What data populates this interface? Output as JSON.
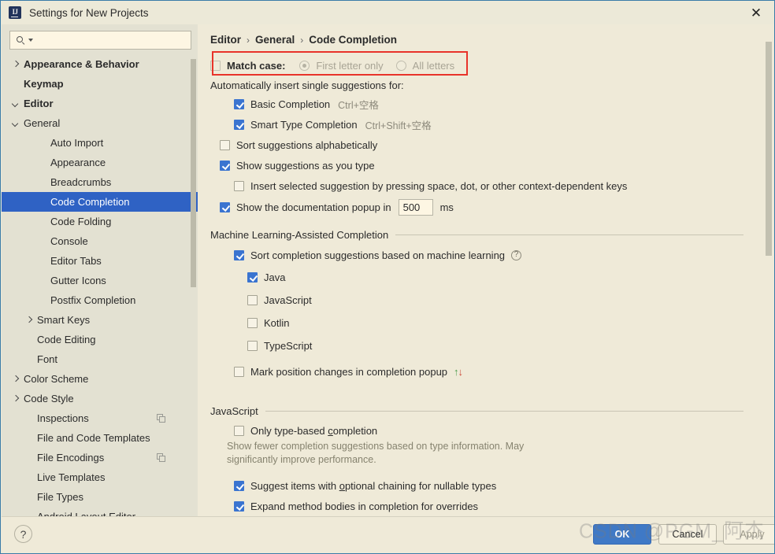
{
  "window": {
    "title": "Settings for New Projects",
    "logo_alt": "IJ",
    "close_label": "✕"
  },
  "sidebar": {
    "search": {
      "value": "",
      "placeholder": ""
    },
    "items": [
      {
        "label": "Appearance & Behavior",
        "indent": 0,
        "twisty": "right",
        "bold": true,
        "selected": false,
        "badge": false
      },
      {
        "label": "Keymap",
        "indent": 1,
        "twisty": "none",
        "bold": true,
        "selected": false,
        "badge": false
      },
      {
        "label": "Editor",
        "indent": 0,
        "twisty": "down",
        "bold": true,
        "selected": false,
        "badge": false
      },
      {
        "label": "General",
        "indent": 1,
        "twisty": "down",
        "bold": false,
        "selected": false,
        "badge": false
      },
      {
        "label": "Auto Import",
        "indent": 3,
        "twisty": "none",
        "bold": false,
        "selected": false,
        "badge": false
      },
      {
        "label": "Appearance",
        "indent": 3,
        "twisty": "none",
        "bold": false,
        "selected": false,
        "badge": false
      },
      {
        "label": "Breadcrumbs",
        "indent": 3,
        "twisty": "none",
        "bold": false,
        "selected": false,
        "badge": false
      },
      {
        "label": "Code Completion",
        "indent": 3,
        "twisty": "none",
        "bold": false,
        "selected": true,
        "badge": false
      },
      {
        "label": "Code Folding",
        "indent": 3,
        "twisty": "none",
        "bold": false,
        "selected": false,
        "badge": false
      },
      {
        "label": "Console",
        "indent": 3,
        "twisty": "none",
        "bold": false,
        "selected": false,
        "badge": false
      },
      {
        "label": "Editor Tabs",
        "indent": 3,
        "twisty": "none",
        "bold": false,
        "selected": false,
        "badge": false
      },
      {
        "label": "Gutter Icons",
        "indent": 3,
        "twisty": "none",
        "bold": false,
        "selected": false,
        "badge": false
      },
      {
        "label": "Postfix Completion",
        "indent": 3,
        "twisty": "none",
        "bold": false,
        "selected": false,
        "badge": false
      },
      {
        "label": "Smart Keys",
        "indent": 2,
        "twisty": "right",
        "bold": false,
        "selected": false,
        "badge": false
      },
      {
        "label": "Code Editing",
        "indent": 2,
        "twisty": "none",
        "bold": false,
        "selected": false,
        "badge": false
      },
      {
        "label": "Font",
        "indent": 2,
        "twisty": "none",
        "bold": false,
        "selected": false,
        "badge": false
      },
      {
        "label": "Color Scheme",
        "indent": 1,
        "twisty": "right",
        "bold": false,
        "selected": false,
        "badge": false
      },
      {
        "label": "Code Style",
        "indent": 1,
        "twisty": "right",
        "bold": false,
        "selected": false,
        "badge": false
      },
      {
        "label": "Inspections",
        "indent": 2,
        "twisty": "none",
        "bold": false,
        "selected": false,
        "badge": true
      },
      {
        "label": "File and Code Templates",
        "indent": 2,
        "twisty": "none",
        "bold": false,
        "selected": false,
        "badge": false
      },
      {
        "label": "File Encodings",
        "indent": 2,
        "twisty": "none",
        "bold": false,
        "selected": false,
        "badge": true
      },
      {
        "label": "Live Templates",
        "indent": 2,
        "twisty": "none",
        "bold": false,
        "selected": false,
        "badge": false
      },
      {
        "label": "File Types",
        "indent": 2,
        "twisty": "none",
        "bold": false,
        "selected": false,
        "badge": false
      },
      {
        "label": "Android Layout Editor",
        "indent": 2,
        "twisty": "none",
        "bold": false,
        "selected": false,
        "badge": false
      }
    ]
  },
  "breadcrumb": {
    "parts": [
      "Editor",
      "General",
      "Code Completion"
    ],
    "separator": "›"
  },
  "main": {
    "match_case": {
      "label": "Match case:",
      "checked": false,
      "options": [
        {
          "label": "First letter only",
          "selected": true
        },
        {
          "label": "All letters",
          "selected": false
        }
      ]
    },
    "auto_insert_heading": "Automatically insert single suggestions for:",
    "auto_insert_items": [
      {
        "label": "Basic Completion",
        "shortcut": "Ctrl+空格",
        "checked": true
      },
      {
        "label": "Smart Type Completion",
        "shortcut": "Ctrl+Shift+空格",
        "checked": true
      }
    ],
    "sort_alphabetically": {
      "label": "Sort suggestions alphabetically",
      "checked": false
    },
    "show_as_you_type": {
      "label": "Show suggestions as you type",
      "checked": true
    },
    "insert_selected": {
      "label": "Insert selected suggestion by pressing space, dot, or other context-dependent keys",
      "checked": false
    },
    "doc_popup": {
      "label": "Show the documentation popup in",
      "checked": true,
      "value": "500",
      "unit": "ms"
    },
    "ml_section": {
      "title": "Machine Learning-Assisted Completion",
      "sort_ml": {
        "label": "Sort completion suggestions based on machine learning",
        "checked": true,
        "help": "?"
      },
      "languages": [
        {
          "label": "Java",
          "checked": true
        },
        {
          "label": "JavaScript",
          "checked": false
        },
        {
          "label": "Kotlin",
          "checked": false
        },
        {
          "label": "TypeScript",
          "checked": false
        }
      ],
      "mark_position": {
        "label": "Mark position changes in completion popup",
        "checked": false,
        "arrow_up": "↑",
        "arrow_down": "↓"
      }
    },
    "js_section": {
      "title": "JavaScript",
      "only_type_based": {
        "label_pre": "Only type-based ",
        "label_mnemonic": "c",
        "label_post": "ompletion",
        "checked": false,
        "description": "Show fewer completion suggestions based on type information. May significantly improve performance."
      },
      "optional_chaining": {
        "label_pre": "Suggest items with ",
        "label_mnemonic": "o",
        "label_post": "ptional chaining for nullable types",
        "checked": true
      },
      "expand_bodies": {
        "label": "Expand method bodies in completion for overrides",
        "checked": true
      }
    }
  },
  "footer": {
    "help": "?",
    "ok": "OK",
    "cancel": "Cancel",
    "apply": "Apply"
  },
  "watermark": "CSDN @PGM_阿杰",
  "colors": {
    "accent_blue": "#3f79c6",
    "selection_blue": "#2f62c4",
    "annotation_red": "#e8332a",
    "background": "#ece9d8",
    "content_bg": "#efead8",
    "sidebar_bg": "#e3e1d2"
  }
}
